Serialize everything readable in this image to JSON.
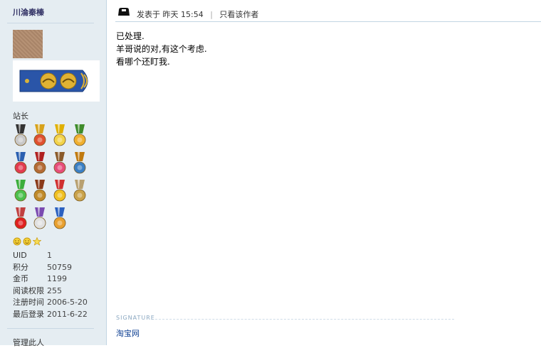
{
  "author": {
    "username": "川淪秦榛",
    "group": "站长",
    "avatar_icon": "avatar-photo",
    "rank_icon": "rank-epaulette-icon"
  },
  "medals": [
    {
      "name": "medal-1-icon",
      "ribbon": "#333333",
      "body": "#c8c8c8"
    },
    {
      "name": "medal-2-icon",
      "ribbon": "#d7a21b",
      "body": "#e05030"
    },
    {
      "name": "medal-3-icon",
      "ribbon": "#e0b000",
      "body": "#f2d34a"
    },
    {
      "name": "medal-4-icon",
      "ribbon": "#3e8c2a",
      "body": "#f0b030"
    },
    {
      "name": "medal-5-icon",
      "ribbon": "#2a5fb0",
      "body": "#e23b50"
    },
    {
      "name": "medal-6-icon",
      "ribbon": "#b02020",
      "body": "#b46a35"
    },
    {
      "name": "medal-7-icon",
      "ribbon": "#8a5a2a",
      "body": "#e64d7a"
    },
    {
      "name": "medal-8-icon",
      "ribbon": "#c07a10",
      "body": "#3a7fc4"
    },
    {
      "name": "medal-9-icon",
      "ribbon": "#3cae3c",
      "body": "#4cc04c"
    },
    {
      "name": "medal-10-icon",
      "ribbon": "#8a3a1a",
      "body": "#c08a2a"
    },
    {
      "name": "medal-11-icon",
      "ribbon": "#d03030",
      "body": "#f0c020"
    },
    {
      "name": "medal-12-icon",
      "ribbon": "#b8a070",
      "body": "#c9a24a"
    },
    {
      "name": "medal-13-icon",
      "ribbon": "#c04040",
      "body": "#e02020"
    },
    {
      "name": "medal-14-icon",
      "ribbon": "#7a4ab0",
      "body": "#e0e0e0"
    },
    {
      "name": "medal-15-icon",
      "ribbon": "#2a60c0",
      "body": "#e8a030"
    }
  ],
  "profile_rows": [
    {
      "key": "UID",
      "value": "1"
    },
    {
      "key": "积分",
      "value": "50759"
    },
    {
      "key": "金币",
      "value": "1199"
    },
    {
      "key": "阅读权限",
      "value": "255"
    },
    {
      "key": "注册时间",
      "value": "2006-5-20"
    },
    {
      "key": "最后登录",
      "value": "2011-6-22"
    }
  ],
  "admin_link": "管理此人",
  "post": {
    "posted_label": "发表于",
    "posted_time": "昨天 15:54",
    "only_author": "只看该作者",
    "lines": [
      "已处理.",
      "羊哥说的对,有这个考虑.",
      "看哪个还盯我."
    ]
  },
  "signature": {
    "label": "SIGNATURE",
    "link": "淘宝网"
  },
  "colors": {
    "sidebar_bg": "#e5edf2",
    "link": "#0b3d91",
    "border": "#c2d5e3"
  }
}
